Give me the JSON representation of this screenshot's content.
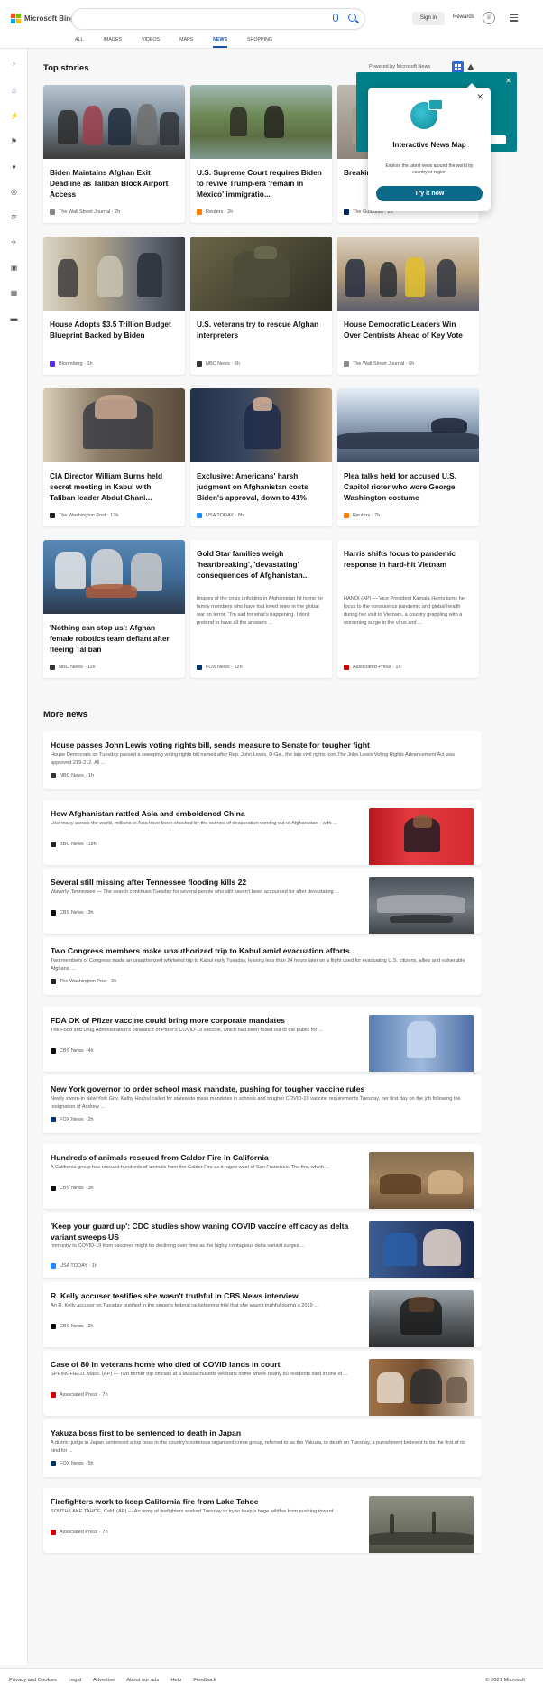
{
  "header": {
    "brand": "Microsoft Bing",
    "signin": "Sign in",
    "rewards": "Rewards",
    "tabs": [
      "ALL",
      "IMAGES",
      "VIDEOS",
      "MAPS",
      "NEWS",
      "SHOPPING"
    ],
    "active_tab": "NEWS"
  },
  "top_stories": {
    "heading": "Top stories",
    "powered_by": "Powered by Microsoft News",
    "cards": [
      {
        "title": "Biden Maintains Afghan Exit Deadline as Taliban Block Airport Access",
        "source": "The Wall Street Journal",
        "age": "2h",
        "logo_color": "#888888",
        "image": "crowd"
      },
      {
        "title": "U.S. Supreme Court requires Biden to revive Trump-era 'remain in Mexico' immigratio...",
        "source": "Reuters",
        "age": "2h",
        "logo_color": "#ff8000",
        "image": "river"
      },
      {
        "title": "Breaking... during premature...",
        "source": "The Guardian",
        "age": "2h",
        "logo_color": "#052962",
        "image": "building"
      },
      {
        "title": "House Adopts $3.5 Trillion Budget Blueprint Backed by Biden",
        "source": "Bloomberg",
        "age": "1h",
        "logo_color": "#5b2be0",
        "image": "speaker"
      },
      {
        "title": "U.S. veterans try to rescue Afghan interpreters",
        "source": "NBC News",
        "age": "6h",
        "logo_color": "#333333",
        "image": "soldier"
      },
      {
        "title": "House Democratic Leaders Win Over Centrists Ahead of Key Vote",
        "source": "The Wall Street Journal",
        "age": "6h",
        "logo_color": "#888888",
        "image": "capitol-hall"
      },
      {
        "title": "CIA Director William Burns held secret meeting in Kabul with Taliban leader Abdul Ghani...",
        "source": "The Washington Post",
        "age": "13h",
        "logo_color": "#222222",
        "image": "portrait"
      },
      {
        "title": "Exclusive: Americans' harsh judgment on Afghanistan costs Biden's approval, down to 41%",
        "source": "USA TODAY",
        "age": "8h",
        "logo_color": "#1a8cff",
        "image": "podium"
      },
      {
        "title": "Plea talks held for accused U.S. Capitol rioter who wore George Washington costume",
        "source": "Reuters",
        "age": "7h",
        "logo_color": "#ff8000",
        "image": "capitol"
      },
      {
        "title": "'Nothing can stop us': Afghan female robotics team defiant after fleeing Taliban",
        "source": "NBC News",
        "age": "11h",
        "logo_color": "#333333",
        "image": "robotics"
      },
      {
        "title": "Gold Star families weigh 'heartbreaking', 'devastating' consequences of Afghanistan...",
        "snippet": "Images of the crisis unfolding in Afghanistan hit home for family members who have lost loved ones in the global war on terror. \"I'm sad for what's happening. I don't pretend to have all the answers ...",
        "source": "FOX News",
        "age": "12h",
        "logo_color": "#003366",
        "image": ""
      },
      {
        "title": "Harris shifts focus to pandemic response in hard-hit Vietnam",
        "snippet": "HANOI (AP) — Vice President Kamala Harris turns her focus to the coronavirus pandemic and global health during her visit to Vietnam, a country grappling with a worsening surge in the virus and ...",
        "source": "Associated Press",
        "age": "1h",
        "logo_color": "#cc0000",
        "image": ""
      }
    ]
  },
  "popup": {
    "title": "Interactive News Map",
    "description": "Explore the latest news around the world by country or region",
    "button": "Try it now"
  },
  "more_news": {
    "heading": "More news",
    "items": [
      {
        "title": "House passes John Lewis voting rights bill, sends measure to Senate for tougher fight",
        "desc": "House Democrats on Tuesday passed a sweeping voting rights bill named after Rep. John Lewis, D-Ga., the late civil rights icon.The John Lewis Voting Rights Advancement Act was approved 219-212. All ...",
        "source": "NBC News",
        "age": "1h",
        "logo_color": "#333333",
        "thumb": ""
      },
      {
        "title": "How Afghanistan rattled Asia and emboldened China",
        "desc": "Like many across the world, millions in Asia have been shocked by the scenes of desperation coming out of Afghanistan - with ...",
        "source": "BBC News",
        "age": "18h",
        "logo_color": "#222222",
        "thumb": "harris"
      },
      {
        "title": "Several still missing after Tennessee flooding kills 22",
        "desc": "Waverly, Tennessee — The search continues Tuesday for several people who still haven't been accounted for after devastating ...",
        "source": "CBS News",
        "age": "3h",
        "logo_color": "#111111",
        "thumb": "flood"
      },
      {
        "title": "Two Congress members make unauthorized trip to Kabul amid evacuation efforts",
        "desc": "Two members of Congress made an unauthorized whirlwind trip to Kabul early Tuesday, leaving less than 24 hours later on a flight used for evacuating U.S. citizens, allies and vulnerable Afghans. ...",
        "source": "The Washington Post",
        "age": "2h",
        "logo_color": "#222222",
        "thumb": ""
      },
      {
        "title": "FDA OK of Pfizer vaccine could bring more corporate mandates",
        "desc": "The Food and Drug Administration's clearance of Pfizer's COVID-19 vaccine, which had been rolled out to the public for ...",
        "source": "CBS News",
        "age": "4h",
        "logo_color": "#111111",
        "thumb": "vial"
      },
      {
        "title": "New York governor to order school mask mandate, pushing for tougher vaccine rules",
        "desc": "Newly sworn-in New York Gov. Kathy Hochul called for statewide mask mandates in schools and tougher COVID-19 vaccine requirements Tuesday, her first day on the job following the resignation of Andrew ...",
        "source": "FOX News",
        "age": "2h",
        "logo_color": "#003366",
        "thumb": ""
      },
      {
        "title": "Hundreds of animals rescued from Caldor Fire in California",
        "desc": "A California group has rescued hundreds of animals from the Caldor Fire as it rages west of San Francisco. The fire, which ...",
        "source": "CBS News",
        "age": "3h",
        "logo_color": "#111111",
        "thumb": "animals"
      },
      {
        "title": "'Keep your guard up': CDC studies show waning COVID vaccine efficacy as delta variant sweeps US",
        "desc": "Immunity to COVID-19 from vaccines might be declining over time as the highly contagious delta variant surges ...",
        "source": "USA TODAY",
        "age": "1h",
        "logo_color": "#1a8cff",
        "thumb": "vaccination"
      },
      {
        "title": "R. Kelly accuser testifies she wasn't truthful in CBS News interview",
        "desc": "An R. Kelly accuser on Tuesday testified in the singer's federal racketeering trial that she wasn't truthful during a 2019 ...",
        "source": "CBS News",
        "age": "2h",
        "logo_color": "#111111",
        "thumb": "rkelly"
      },
      {
        "title": "Case of 80 in veterans home who died of COVID lands in court",
        "desc": "SPRINGFIELD, Mass. (AP) — Two former top officials at a Massachusetts veterans home where nearly 80 residents died in one of ...",
        "source": "Associated Press",
        "age": "7h",
        "logo_color": "#cc0000",
        "thumb": "court"
      },
      {
        "title": "Yakuza boss first to be sentenced to death in Japan",
        "desc": "A district judge in Japan sentenced a top boss in the country's notorious organized crime group, referred to as the Yakuza, to death on Tuesday, a punishment believed to be the first of its kind for ...",
        "source": "FOX News",
        "age": "5h",
        "logo_color": "#003366",
        "thumb": ""
      },
      {
        "title": "Firefighters work to keep California fire from Lake Tahoe",
        "desc": "SOUTH LAKE TAHOE, Calif. (AP) — An army of firefighters worked Tuesday to try to keep a huge wildfire from pushing toward ...",
        "source": "Associated Press",
        "age": "7h",
        "logo_color": "#cc0000",
        "thumb": "smoke"
      }
    ]
  },
  "footer": {
    "links": [
      "Privacy and Cookies",
      "Legal",
      "Advertise",
      "About our ads",
      "Help",
      "Feedback"
    ],
    "copyright": "© 2021 Microsoft"
  }
}
